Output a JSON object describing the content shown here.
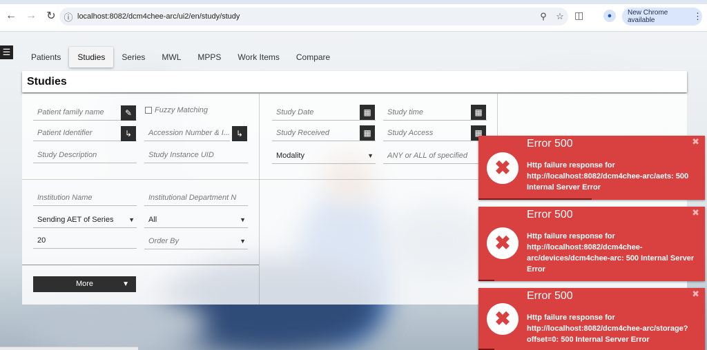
{
  "browser": {
    "url": "localhost:8082/dcm4chee-arc/ui2/en/study/study",
    "update_label": "New Chrome available",
    "back_icon": "back-arrow-icon",
    "forward_icon": "forward-arrow-icon",
    "reload_icon": "reload-icon",
    "zoom_icon": "zoom-icon",
    "star_icon": "bookmark-star-icon",
    "extensions_icon": "extensions-icon",
    "profile_icon": "profile-icon"
  },
  "tabs": [
    "Patients",
    "Studies",
    "Series",
    "MWL",
    "MPPS",
    "Work Items",
    "Compare"
  ],
  "active_tab": "Studies",
  "page_title": "Studies",
  "form": {
    "patient_family_name": "Patient family name",
    "fuzzy_matching": "Fuzzy Matching",
    "patient_identifier": "Patient Identifier",
    "accession_number": "Accession Number & I...",
    "study_description": "Study Description",
    "study_instance_uid": "Study Instance UID",
    "study_date": "Study Date",
    "study_time": "Study time",
    "study_received": "Study Received",
    "study_access": "Study Access",
    "modality": "Modality",
    "any_or_all": "ANY or ALL of specified",
    "institution_name": "Institution Name",
    "institutional_department": "Institutional Department N",
    "sending_aet": "Sending AET of Series",
    "sending_aet_value": "All",
    "limit": "20",
    "order_by": "Order By",
    "more_label": "More"
  },
  "toasts": [
    {
      "title": "Error 500",
      "message": "Http failure response for http://localhost:8082/dcm4chee-arc/aets: 500 Internal Server Error",
      "progress": 0.5
    },
    {
      "title": "Error 500",
      "message": "Http failure response for http://localhost:8082/dcm4chee-arc/devices/dcm4chee-arc: 500 Internal Server Error",
      "progress": 0.07
    },
    {
      "title": "Error 500",
      "message": "Http failure response for http://localhost:8082/dcm4chee-arc/storage?offset=0: 500 Internal Server Error",
      "progress": 0.07
    }
  ],
  "colors": {
    "toast_red": "#d94141",
    "button_dark": "#2d2d2d"
  }
}
